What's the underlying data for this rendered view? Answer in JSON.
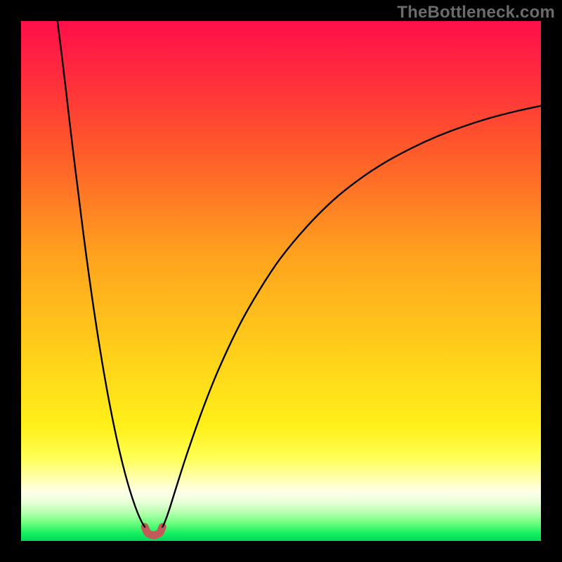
{
  "watermark": "TheBottleneck.com",
  "chart_data": {
    "type": "line",
    "title": "",
    "xlabel": "",
    "ylabel": "",
    "xlim": [
      0,
      100
    ],
    "ylim": [
      0,
      100
    ],
    "grid": false,
    "legend": false,
    "background_gradient_stops": [
      {
        "offset": 0.0,
        "color": "#ff0f4a"
      },
      {
        "offset": 0.1,
        "color": "#ff2a3e"
      },
      {
        "offset": 0.25,
        "color": "#ff5a2a"
      },
      {
        "offset": 0.45,
        "color": "#ffa21e"
      },
      {
        "offset": 0.65,
        "color": "#ffd21a"
      },
      {
        "offset": 0.78,
        "color": "#fff01a"
      },
      {
        "offset": 0.84,
        "color": "#ffff55"
      },
      {
        "offset": 0.88,
        "color": "#ffffb0"
      },
      {
        "offset": 0.905,
        "color": "#ffffe8"
      },
      {
        "offset": 0.925,
        "color": "#e8ffd8"
      },
      {
        "offset": 0.945,
        "color": "#b8ffb0"
      },
      {
        "offset": 0.965,
        "color": "#70ff80"
      },
      {
        "offset": 0.985,
        "color": "#18f060"
      },
      {
        "offset": 1.0,
        "color": "#00d85a"
      }
    ],
    "series": [
      {
        "name": "curve-A",
        "stroke": "#000000",
        "stroke_width": 2.4,
        "points": [
          {
            "x": 7.0,
            "y": 100.0
          },
          {
            "x": 8.0,
            "y": 92.0
          },
          {
            "x": 9.0,
            "y": 83.5
          },
          {
            "x": 10.0,
            "y": 75.0
          },
          {
            "x": 11.0,
            "y": 67.0
          },
          {
            "x": 12.0,
            "y": 59.0
          },
          {
            "x": 13.0,
            "y": 51.5
          },
          {
            "x": 14.0,
            "y": 44.5
          },
          {
            "x": 15.0,
            "y": 38.0
          },
          {
            "x": 16.0,
            "y": 32.0
          },
          {
            "x": 17.0,
            "y": 26.5
          },
          {
            "x": 18.0,
            "y": 21.5
          },
          {
            "x": 19.0,
            "y": 17.0
          },
          {
            "x": 20.0,
            "y": 13.0
          },
          {
            "x": 21.0,
            "y": 9.5
          },
          {
            "x": 22.0,
            "y": 6.5
          },
          {
            "x": 22.8,
            "y": 4.5
          },
          {
            "x": 23.4,
            "y": 3.3
          },
          {
            "x": 23.8,
            "y": 2.7
          }
        ]
      },
      {
        "name": "curve-B",
        "stroke": "#000000",
        "stroke_width": 2.4,
        "points": [
          {
            "x": 27.2,
            "y": 2.7
          },
          {
            "x": 27.6,
            "y": 3.5
          },
          {
            "x": 28.5,
            "y": 6.0
          },
          {
            "x": 30.0,
            "y": 10.8
          },
          {
            "x": 32.0,
            "y": 17.0
          },
          {
            "x": 35.0,
            "y": 25.5
          },
          {
            "x": 38.0,
            "y": 33.0
          },
          {
            "x": 42.0,
            "y": 41.5
          },
          {
            "x": 46.0,
            "y": 48.5
          },
          {
            "x": 50.0,
            "y": 54.5
          },
          {
            "x": 55.0,
            "y": 60.5
          },
          {
            "x": 60.0,
            "y": 65.5
          },
          {
            "x": 65.0,
            "y": 69.5
          },
          {
            "x": 70.0,
            "y": 72.8
          },
          {
            "x": 75.0,
            "y": 75.5
          },
          {
            "x": 80.0,
            "y": 77.8
          },
          {
            "x": 85.0,
            "y": 79.7
          },
          {
            "x": 90.0,
            "y": 81.3
          },
          {
            "x": 95.0,
            "y": 82.6
          },
          {
            "x": 100.0,
            "y": 83.7
          }
        ]
      }
    ],
    "marker": {
      "name": "min-highlight",
      "color": "#c25a5a",
      "stroke_width": 11,
      "points": [
        {
          "x": 23.8,
          "y": 2.7
        },
        {
          "x": 24.3,
          "y": 1.6
        },
        {
          "x": 25.0,
          "y": 1.2
        },
        {
          "x": 25.5,
          "y": 1.1
        },
        {
          "x": 26.0,
          "y": 1.2
        },
        {
          "x": 26.7,
          "y": 1.6
        },
        {
          "x": 27.2,
          "y": 2.7
        }
      ]
    }
  }
}
